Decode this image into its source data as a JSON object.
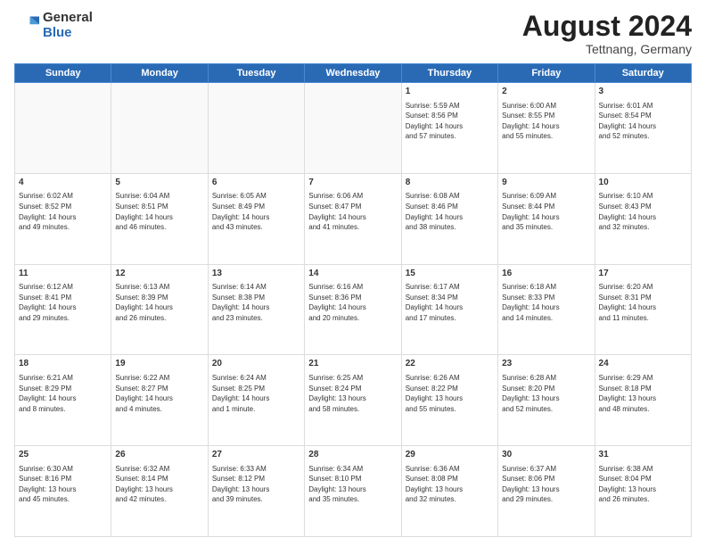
{
  "header": {
    "logo_general": "General",
    "logo_blue": "Blue",
    "month_title": "August 2024",
    "location": "Tettnang, Germany"
  },
  "calendar": {
    "days_of_week": [
      "Sunday",
      "Monday",
      "Tuesday",
      "Wednesday",
      "Thursday",
      "Friday",
      "Saturday"
    ],
    "weeks": [
      [
        {
          "day": "",
          "text": ""
        },
        {
          "day": "",
          "text": ""
        },
        {
          "day": "",
          "text": ""
        },
        {
          "day": "",
          "text": ""
        },
        {
          "day": "1",
          "text": "Sunrise: 5:59 AM\nSunset: 8:56 PM\nDaylight: 14 hours\nand 57 minutes."
        },
        {
          "day": "2",
          "text": "Sunrise: 6:00 AM\nSunset: 8:55 PM\nDaylight: 14 hours\nand 55 minutes."
        },
        {
          "day": "3",
          "text": "Sunrise: 6:01 AM\nSunset: 8:54 PM\nDaylight: 14 hours\nand 52 minutes."
        }
      ],
      [
        {
          "day": "4",
          "text": "Sunrise: 6:02 AM\nSunset: 8:52 PM\nDaylight: 14 hours\nand 49 minutes."
        },
        {
          "day": "5",
          "text": "Sunrise: 6:04 AM\nSunset: 8:51 PM\nDaylight: 14 hours\nand 46 minutes."
        },
        {
          "day": "6",
          "text": "Sunrise: 6:05 AM\nSunset: 8:49 PM\nDaylight: 14 hours\nand 43 minutes."
        },
        {
          "day": "7",
          "text": "Sunrise: 6:06 AM\nSunset: 8:47 PM\nDaylight: 14 hours\nand 41 minutes."
        },
        {
          "day": "8",
          "text": "Sunrise: 6:08 AM\nSunset: 8:46 PM\nDaylight: 14 hours\nand 38 minutes."
        },
        {
          "day": "9",
          "text": "Sunrise: 6:09 AM\nSunset: 8:44 PM\nDaylight: 14 hours\nand 35 minutes."
        },
        {
          "day": "10",
          "text": "Sunrise: 6:10 AM\nSunset: 8:43 PM\nDaylight: 14 hours\nand 32 minutes."
        }
      ],
      [
        {
          "day": "11",
          "text": "Sunrise: 6:12 AM\nSunset: 8:41 PM\nDaylight: 14 hours\nand 29 minutes."
        },
        {
          "day": "12",
          "text": "Sunrise: 6:13 AM\nSunset: 8:39 PM\nDaylight: 14 hours\nand 26 minutes."
        },
        {
          "day": "13",
          "text": "Sunrise: 6:14 AM\nSunset: 8:38 PM\nDaylight: 14 hours\nand 23 minutes."
        },
        {
          "day": "14",
          "text": "Sunrise: 6:16 AM\nSunset: 8:36 PM\nDaylight: 14 hours\nand 20 minutes."
        },
        {
          "day": "15",
          "text": "Sunrise: 6:17 AM\nSunset: 8:34 PM\nDaylight: 14 hours\nand 17 minutes."
        },
        {
          "day": "16",
          "text": "Sunrise: 6:18 AM\nSunset: 8:33 PM\nDaylight: 14 hours\nand 14 minutes."
        },
        {
          "day": "17",
          "text": "Sunrise: 6:20 AM\nSunset: 8:31 PM\nDaylight: 14 hours\nand 11 minutes."
        }
      ],
      [
        {
          "day": "18",
          "text": "Sunrise: 6:21 AM\nSunset: 8:29 PM\nDaylight: 14 hours\nand 8 minutes."
        },
        {
          "day": "19",
          "text": "Sunrise: 6:22 AM\nSunset: 8:27 PM\nDaylight: 14 hours\nand 4 minutes."
        },
        {
          "day": "20",
          "text": "Sunrise: 6:24 AM\nSunset: 8:25 PM\nDaylight: 14 hours\nand 1 minute."
        },
        {
          "day": "21",
          "text": "Sunrise: 6:25 AM\nSunset: 8:24 PM\nDaylight: 13 hours\nand 58 minutes."
        },
        {
          "day": "22",
          "text": "Sunrise: 6:26 AM\nSunset: 8:22 PM\nDaylight: 13 hours\nand 55 minutes."
        },
        {
          "day": "23",
          "text": "Sunrise: 6:28 AM\nSunset: 8:20 PM\nDaylight: 13 hours\nand 52 minutes."
        },
        {
          "day": "24",
          "text": "Sunrise: 6:29 AM\nSunset: 8:18 PM\nDaylight: 13 hours\nand 48 minutes."
        }
      ],
      [
        {
          "day": "25",
          "text": "Sunrise: 6:30 AM\nSunset: 8:16 PM\nDaylight: 13 hours\nand 45 minutes."
        },
        {
          "day": "26",
          "text": "Sunrise: 6:32 AM\nSunset: 8:14 PM\nDaylight: 13 hours\nand 42 minutes."
        },
        {
          "day": "27",
          "text": "Sunrise: 6:33 AM\nSunset: 8:12 PM\nDaylight: 13 hours\nand 39 minutes."
        },
        {
          "day": "28",
          "text": "Sunrise: 6:34 AM\nSunset: 8:10 PM\nDaylight: 13 hours\nand 35 minutes."
        },
        {
          "day": "29",
          "text": "Sunrise: 6:36 AM\nSunset: 8:08 PM\nDaylight: 13 hours\nand 32 minutes."
        },
        {
          "day": "30",
          "text": "Sunrise: 6:37 AM\nSunset: 8:06 PM\nDaylight: 13 hours\nand 29 minutes."
        },
        {
          "day": "31",
          "text": "Sunrise: 6:38 AM\nSunset: 8:04 PM\nDaylight: 13 hours\nand 26 minutes."
        }
      ]
    ]
  }
}
